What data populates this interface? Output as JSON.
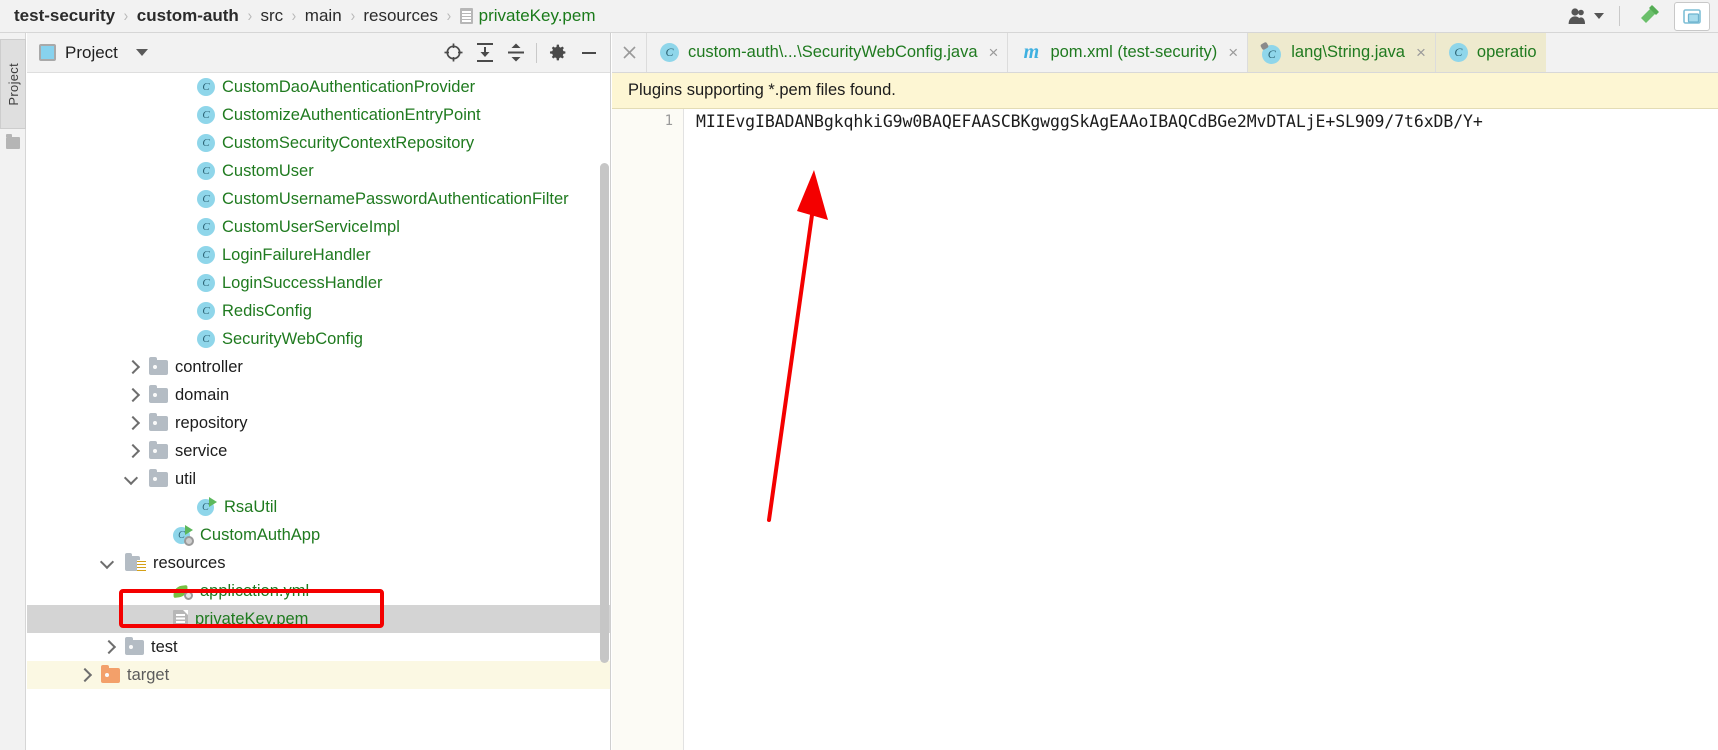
{
  "navbar": {
    "breadcrumbs": [
      {
        "label": "test-security",
        "style": "bold"
      },
      {
        "label": "custom-auth",
        "style": "bold"
      },
      {
        "label": "src",
        "style": "normal"
      },
      {
        "label": "main",
        "style": "normal"
      },
      {
        "label": "resources",
        "style": "normal"
      },
      {
        "label": "privateKey.pem",
        "style": "file"
      }
    ],
    "separator": "›",
    "icons": {
      "user": "user-icon",
      "dropdown": "chevron-down-icon",
      "hammer": "build-hammer-icon",
      "window": "restore-window-icon"
    }
  },
  "tool_strip": {
    "project_tab_label": "Project",
    "structure_icon": "structure-icon"
  },
  "project_panel": {
    "title": "Project",
    "toolbar": [
      {
        "name": "scroll-from-source-icon",
        "glyph": "⊕"
      },
      {
        "name": "expand-all-icon",
        "glyph": "⤓"
      },
      {
        "name": "collapse-all-icon",
        "glyph": "⤒"
      },
      {
        "name": "settings-gear-icon",
        "glyph": "⚙"
      },
      {
        "name": "hide-panel-icon",
        "glyph": "−"
      }
    ],
    "tree": [
      {
        "label": "CustomDaoAuthenticationProvider",
        "icon": "class-icon",
        "indent": 5,
        "twisty": "none",
        "color": "green",
        "state": "normal"
      },
      {
        "label": "CustomizeAuthenticationEntryPoint",
        "icon": "class-icon",
        "indent": 5,
        "twisty": "none",
        "color": "green",
        "state": "normal"
      },
      {
        "label": "CustomSecurityContextRepository",
        "icon": "class-icon",
        "indent": 5,
        "twisty": "none",
        "color": "green",
        "state": "normal"
      },
      {
        "label": "CustomUser",
        "icon": "class-icon",
        "indent": 5,
        "twisty": "none",
        "color": "green",
        "state": "normal"
      },
      {
        "label": "CustomUsernamePasswordAuthenticationFilter",
        "icon": "class-icon",
        "indent": 5,
        "twisty": "none",
        "color": "green",
        "state": "normal"
      },
      {
        "label": "CustomUserServiceImpl",
        "icon": "class-icon",
        "indent": 5,
        "twisty": "none",
        "color": "green",
        "state": "normal"
      },
      {
        "label": "LoginFailureHandler",
        "icon": "class-icon",
        "indent": 5,
        "twisty": "none",
        "color": "green",
        "state": "normal"
      },
      {
        "label": "LoginSuccessHandler",
        "icon": "class-icon",
        "indent": 5,
        "twisty": "none",
        "color": "green",
        "state": "normal"
      },
      {
        "label": "RedisConfig",
        "icon": "class-icon",
        "indent": 5,
        "twisty": "none",
        "color": "green",
        "state": "normal"
      },
      {
        "label": "SecurityWebConfig",
        "icon": "class-icon",
        "indent": 5,
        "twisty": "none",
        "color": "green",
        "state": "normal"
      },
      {
        "label": "controller",
        "icon": "folder-icon",
        "indent": 3,
        "twisty": "right",
        "color": "dark",
        "state": "normal"
      },
      {
        "label": "domain",
        "icon": "folder-icon",
        "indent": 3,
        "twisty": "right",
        "color": "dark",
        "state": "normal"
      },
      {
        "label": "repository",
        "icon": "folder-icon",
        "indent": 3,
        "twisty": "right",
        "color": "dark",
        "state": "normal"
      },
      {
        "label": "service",
        "icon": "folder-icon",
        "indent": 3,
        "twisty": "right",
        "color": "dark",
        "state": "normal"
      },
      {
        "label": "util",
        "icon": "folder-icon",
        "indent": 3,
        "twisty": "down",
        "color": "dark",
        "state": "normal"
      },
      {
        "label": "RsaUtil",
        "icon": "runnable-class-icon",
        "indent": 5,
        "twisty": "none",
        "color": "green",
        "state": "normal"
      },
      {
        "label": "CustomAuthApp",
        "icon": "spring-class-icon",
        "indent": 4,
        "twisty": "none",
        "color": "green",
        "state": "normal"
      },
      {
        "label": "resources",
        "icon": "resources-folder-icon",
        "indent": 2,
        "twisty": "down",
        "color": "dark",
        "state": "normal"
      },
      {
        "label": "application.yml",
        "icon": "yaml-spring-icon",
        "indent": 4,
        "twisty": "none",
        "color": "green",
        "state": "normal"
      },
      {
        "label": "privateKey.pem",
        "icon": "pem-file-icon",
        "indent": 4,
        "twisty": "none",
        "color": "green",
        "state": "selected"
      },
      {
        "label": "test",
        "icon": "folder-icon",
        "indent": 2,
        "twisty": "right",
        "color": "dark",
        "state": "normal"
      },
      {
        "label": "target",
        "icon": "folder-orange-icon",
        "indent": 1,
        "twisty": "right",
        "color": "dim",
        "state": "tan"
      }
    ]
  },
  "editor": {
    "tabs": [
      {
        "label": "custom-auth\\...\\SecurityWebConfig.java",
        "icon": "java-class-icon",
        "active": false,
        "closable": true
      },
      {
        "label": "pom.xml (test-security)",
        "icon": "maven-icon",
        "active": false,
        "closable": true
      },
      {
        "label": "lang\\String.java",
        "icon": "library-class-icon",
        "active": true,
        "closable": true
      },
      {
        "label": "operatio",
        "icon": "java-class-icon",
        "active": true,
        "closable": false
      }
    ],
    "close_all_icon": "close-icon",
    "notification": "Plugins supporting *.pem files found.",
    "line_number": "1",
    "line_text": "MIIEvgIBADANBgkqhkiG9w0BAQEFAASCBKgwggSkAgEAAoIBAQCdBGe2MvDTALjE+SL909/7t6xDB/Y+"
  },
  "annotation": {
    "highlight_color": "#f40000",
    "arrow_color": "#f40000"
  }
}
